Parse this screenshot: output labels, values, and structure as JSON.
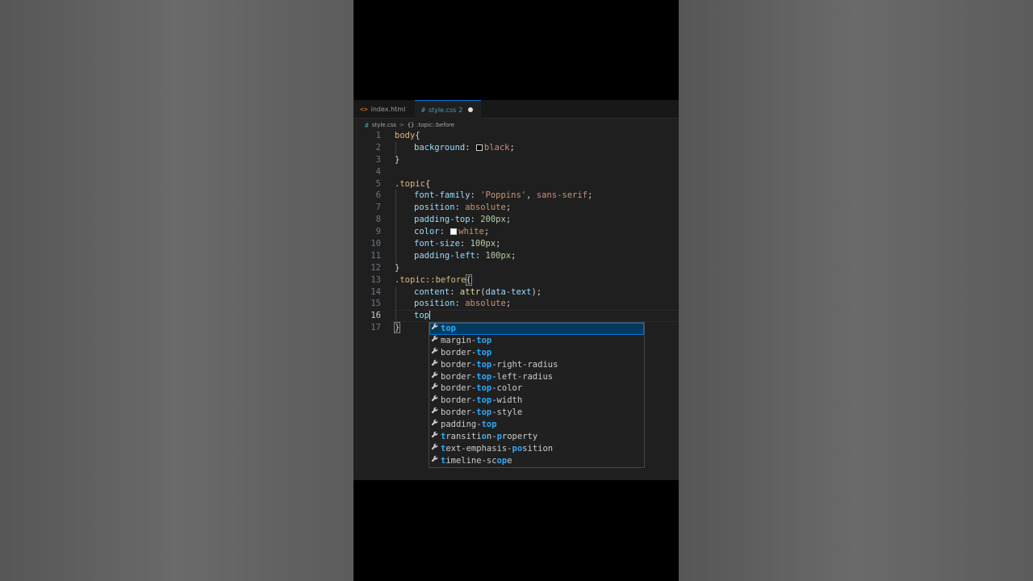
{
  "tabs": [
    {
      "icon": "<>",
      "label": "index.html"
    },
    {
      "icon": "#",
      "label": "style.css",
      "badge": "2"
    }
  ],
  "breadcrumb": {
    "file_icon": "#",
    "file": "style.css",
    "sep": ">",
    "symbol_icon": "{}",
    "symbol": ".topic::before"
  },
  "lines": [
    {
      "n": "1",
      "parts": [
        [
          "sel",
          "body"
        ],
        [
          "brace",
          "{"
        ]
      ]
    },
    {
      "n": "2",
      "indent": 1,
      "parts": [
        [
          "prop",
          "background"
        ],
        [
          "brace",
          ": "
        ],
        [
          "swatch",
          "black"
        ],
        [
          "val",
          "black"
        ],
        [
          "brace",
          ";"
        ]
      ]
    },
    {
      "n": "3",
      "parts": [
        [
          "brace",
          "}"
        ]
      ]
    },
    {
      "n": "4",
      "parts": []
    },
    {
      "n": "5",
      "parts": [
        [
          "sel",
          ".topic"
        ],
        [
          "brace",
          "{"
        ]
      ]
    },
    {
      "n": "6",
      "indent": 1,
      "parts": [
        [
          "prop",
          "font-family"
        ],
        [
          "brace",
          ": "
        ],
        [
          "val",
          "'Poppins'"
        ],
        [
          "brace",
          ", "
        ],
        [
          "val",
          "sans-serif"
        ],
        [
          "brace",
          ";"
        ]
      ]
    },
    {
      "n": "7",
      "indent": 1,
      "parts": [
        [
          "prop",
          "position"
        ],
        [
          "brace",
          ": "
        ],
        [
          "val",
          "absolute"
        ],
        [
          "brace",
          ";"
        ]
      ]
    },
    {
      "n": "8",
      "indent": 1,
      "parts": [
        [
          "prop",
          "padding-top"
        ],
        [
          "brace",
          ": "
        ],
        [
          "num",
          "200px"
        ],
        [
          "brace",
          ";"
        ]
      ]
    },
    {
      "n": "9",
      "indent": 1,
      "parts": [
        [
          "prop",
          "color"
        ],
        [
          "brace",
          ": "
        ],
        [
          "swatch",
          "white"
        ],
        [
          "val",
          "white"
        ],
        [
          "brace",
          ";"
        ]
      ]
    },
    {
      "n": "10",
      "indent": 1,
      "parts": [
        [
          "prop",
          "font-size"
        ],
        [
          "brace",
          ": "
        ],
        [
          "num",
          "100px"
        ],
        [
          "brace",
          ";"
        ]
      ]
    },
    {
      "n": "11",
      "indent": 1,
      "parts": [
        [
          "prop",
          "padding-left"
        ],
        [
          "brace",
          ": "
        ],
        [
          "num",
          "100px"
        ],
        [
          "brace",
          ";"
        ]
      ]
    },
    {
      "n": "12",
      "parts": [
        [
          "brace",
          "}"
        ]
      ]
    },
    {
      "n": "13",
      "parts": [
        [
          "sel",
          ".topic::before"
        ],
        [
          "bracematch",
          "{"
        ]
      ]
    },
    {
      "n": "14",
      "indent": 1,
      "parts": [
        [
          "prop",
          "content"
        ],
        [
          "brace",
          ": "
        ],
        [
          "fn",
          "attr"
        ],
        [
          "brace",
          "("
        ],
        [
          "prop",
          "data-text"
        ],
        [
          "brace",
          ");"
        ]
      ]
    },
    {
      "n": "15",
      "indent": 1,
      "parts": [
        [
          "prop",
          "position"
        ],
        [
          "brace",
          ": "
        ],
        [
          "val",
          "absolute"
        ],
        [
          "brace",
          ";"
        ]
      ]
    },
    {
      "n": "16",
      "indent": 1,
      "current": true,
      "parts": [
        [
          "prop",
          "top"
        ],
        [
          "cursor",
          ""
        ]
      ]
    },
    {
      "n": "17",
      "parts": [
        [
          "bracematch",
          "}"
        ]
      ]
    }
  ],
  "suggestions": [
    {
      "pre": "",
      "hl": "top",
      "post": "",
      "selected": true
    },
    {
      "pre": "margin-",
      "hl": "top",
      "post": ""
    },
    {
      "pre": "border-",
      "hl": "top",
      "post": ""
    },
    {
      "pre": "border-",
      "hl": "top",
      "post": "-right-radius"
    },
    {
      "pre": "border-",
      "hl": "top",
      "post": "-left-radius"
    },
    {
      "pre": "border-",
      "hl": "top",
      "post": "-color"
    },
    {
      "pre": "border-",
      "hl": "top",
      "post": "-width"
    },
    {
      "pre": "border-",
      "hl": "top",
      "post": "-style"
    },
    {
      "pre": "padding-",
      "hl": "top",
      "post": ""
    },
    {
      "segments": [
        [
          "hl",
          "t"
        ],
        [
          "",
          "ransiti"
        ],
        [
          "hl",
          "o"
        ],
        [
          "",
          "n-"
        ],
        [
          "hl",
          "p"
        ],
        [
          "",
          "roperty"
        ]
      ]
    },
    {
      "segments": [
        [
          "hl",
          "t"
        ],
        [
          "",
          "ext-emphasis-"
        ],
        [
          "hl",
          "po"
        ],
        [
          "",
          "sition"
        ]
      ]
    },
    {
      "segments": [
        [
          "hl",
          "t"
        ],
        [
          "",
          "imeline-sc"
        ],
        [
          "hl",
          "op"
        ],
        [
          "",
          "e"
        ]
      ]
    }
  ],
  "icons": {
    "suggestion": "wrench-icon",
    "wrench_glyph": "🔧"
  }
}
